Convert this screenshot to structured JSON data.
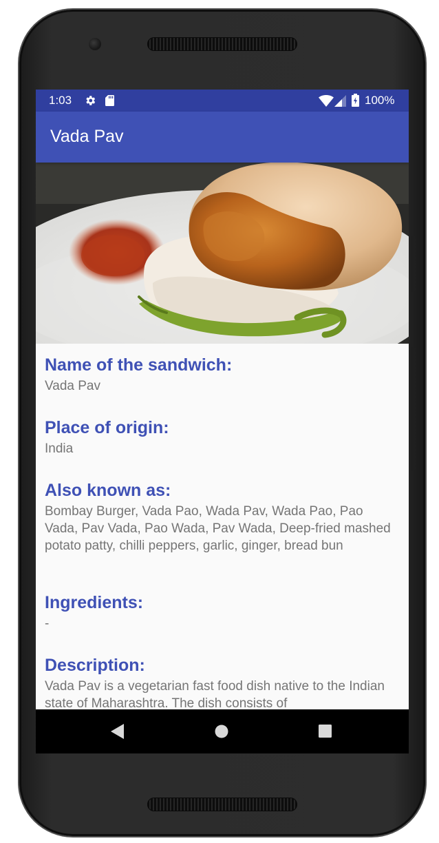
{
  "status_bar": {
    "time": "1:03",
    "battery_percent": "100%",
    "icons": [
      "gear-icon",
      "sd-card-icon",
      "wifi-icon",
      "cell-signal-icon",
      "battery-icon"
    ]
  },
  "app_bar": {
    "title": "Vada Pav"
  },
  "image": {
    "subject": "vada-pav-photo"
  },
  "details": {
    "name": {
      "heading": "Name of the sandwich:",
      "value": "Vada Pav"
    },
    "origin": {
      "heading": "Place of origin:",
      "value": "India"
    },
    "aka": {
      "heading": "Also known as:",
      "value": "Bombay Burger, Vada Pao, Wada Pav, Wada Pao, Pao Vada, Pav Vada, Pao Wada, Pav Wada, Deep-fried mashed potato patty, chilli peppers, garlic, ginger, bread bun"
    },
    "ingredients": {
      "heading": "Ingredients:",
      "value": "-"
    },
    "description": {
      "heading": "Description:",
      "value": "Vada Pav is a vegetarian fast food dish native to the Indian state of Maharashtra. The dish consists of"
    }
  },
  "nav_bar": {
    "icons": [
      "back-icon",
      "home-icon",
      "recents-icon"
    ]
  },
  "colors": {
    "primary": "#3f51b5",
    "primary_dark": "#303f9f",
    "body_text": "#757575",
    "screen_bg": "#fafafa"
  }
}
